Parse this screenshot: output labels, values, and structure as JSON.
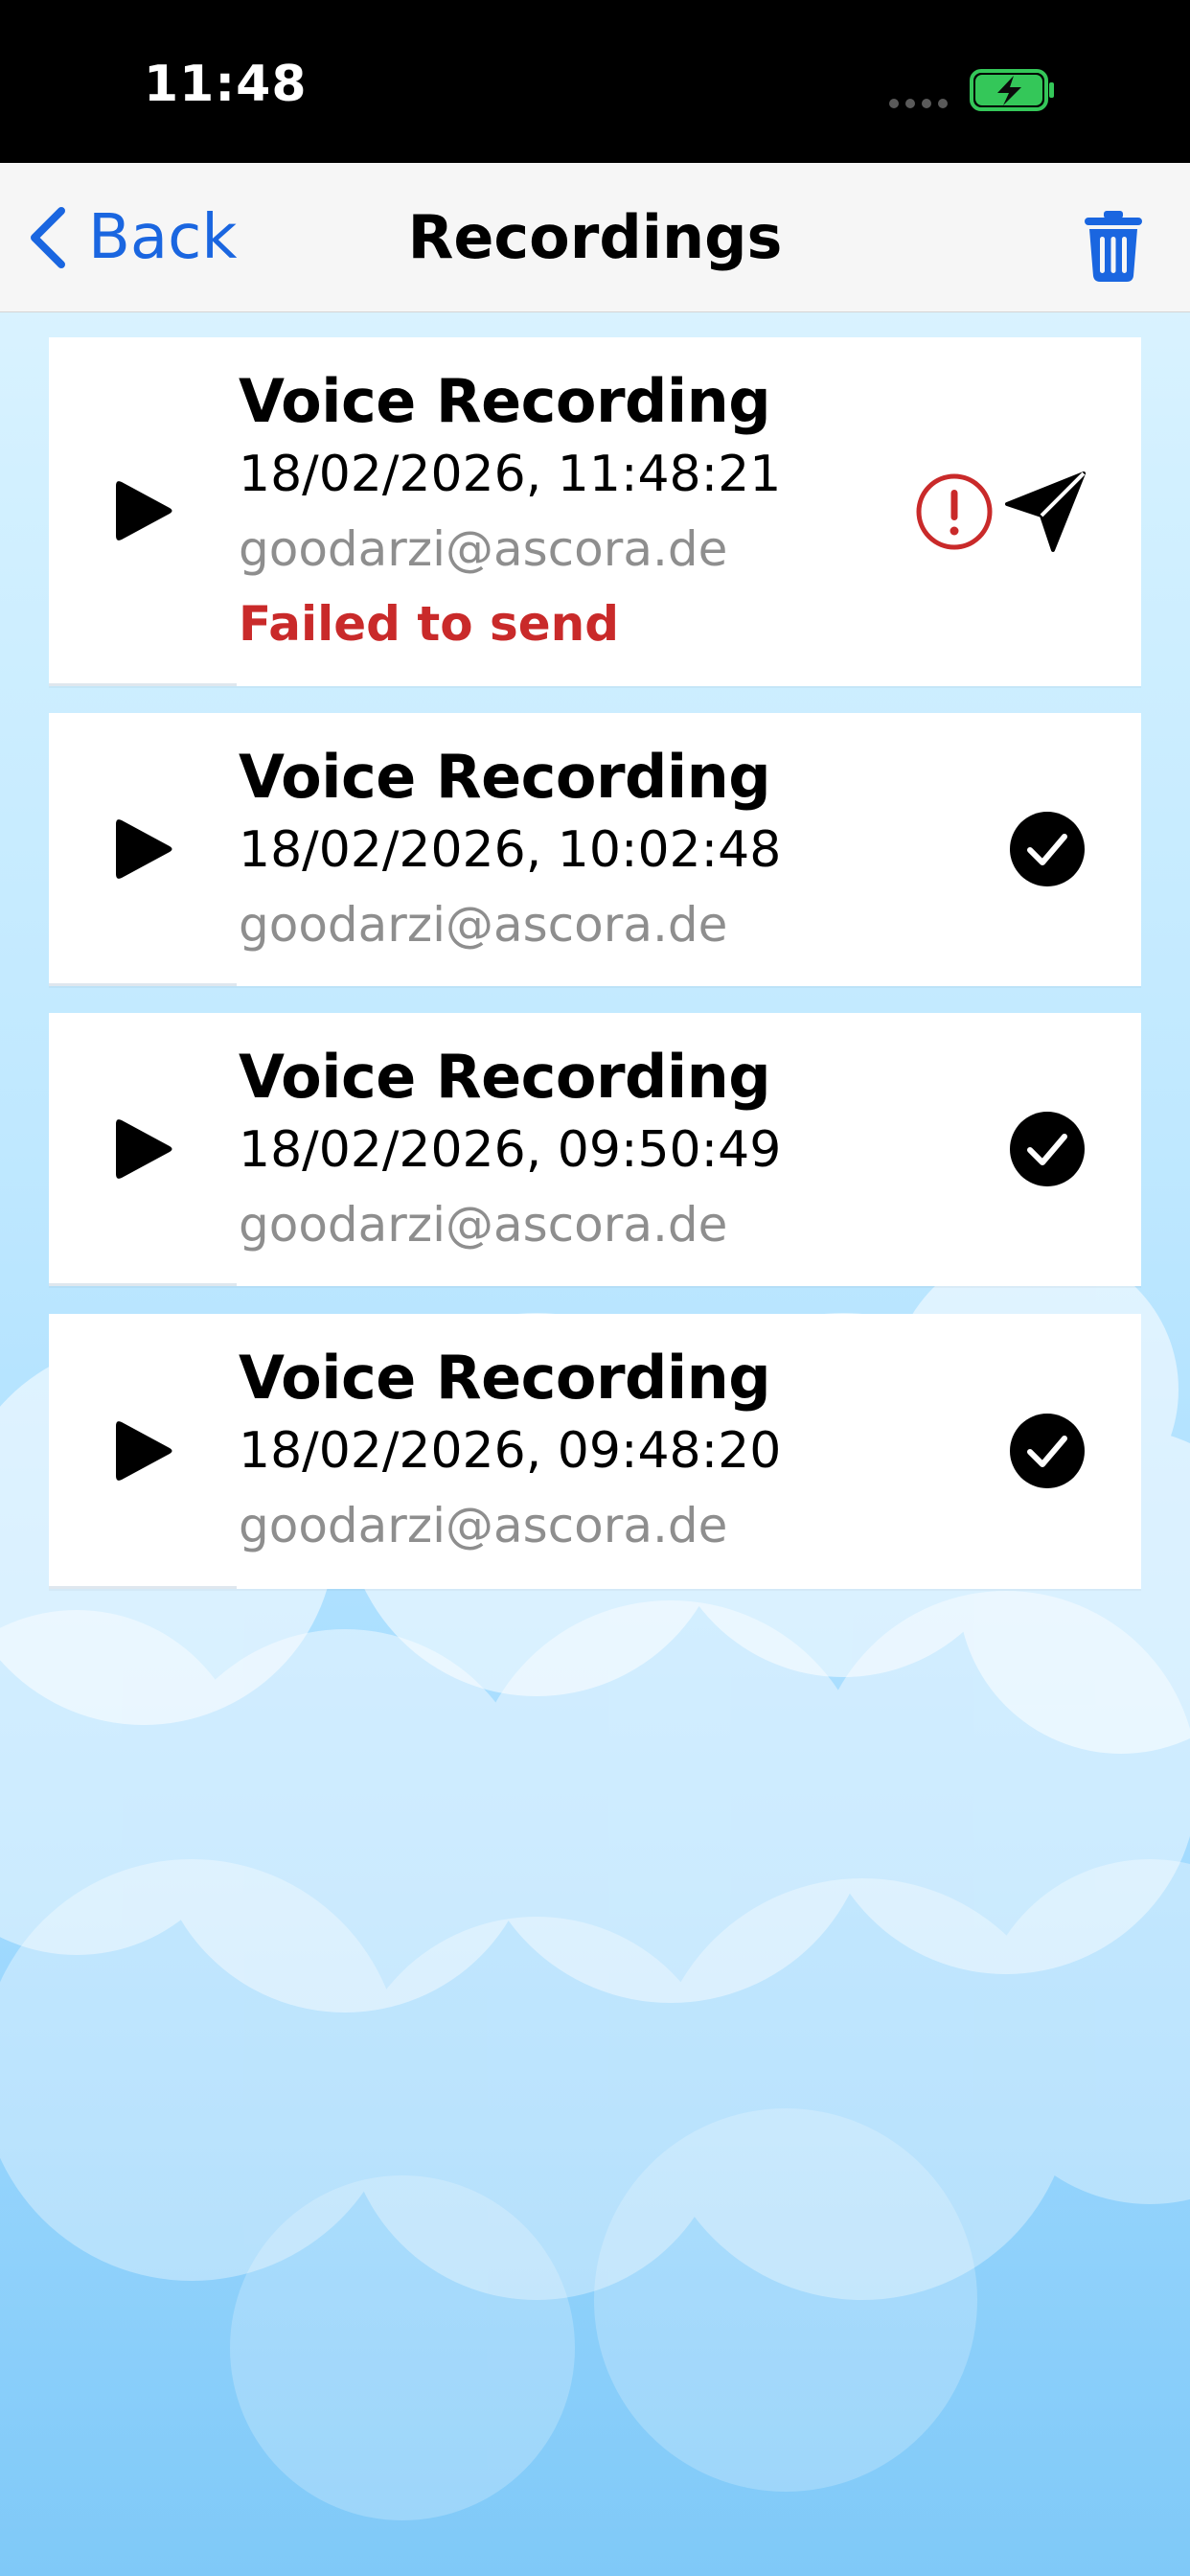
{
  "status_bar": {
    "time": "11:48"
  },
  "nav": {
    "back_label": "Back",
    "title": "Recordings"
  },
  "recordings": [
    {
      "title": "Voice Recording",
      "date": "18/02/2026, 11:48:21",
      "email": "goodarzi@ascora.de",
      "error": "Failed to send",
      "status": "failed"
    },
    {
      "title": "Voice Recording",
      "date": "18/02/2026, 10:02:48",
      "email": "goodarzi@ascora.de",
      "status": "sent"
    },
    {
      "title": "Voice Recording",
      "date": "18/02/2026, 09:50:49",
      "email": "goodarzi@ascora.de",
      "status": "sent"
    },
    {
      "title": "Voice Recording",
      "date": "18/02/2026, 09:48:20",
      "email": "goodarzi@ascora.de",
      "status": "sent"
    }
  ],
  "icons": {
    "back": "chevron-left-icon",
    "trash": "trash-icon",
    "play": "play-icon",
    "alert": "exclamation-circle-icon",
    "send": "paper-plane-icon",
    "sent": "checkmark-circle-icon",
    "battery": "battery-charging-icon"
  },
  "colors": {
    "accent": "#1a66e0",
    "error": "#c92a2a",
    "battery": "#34c759",
    "secondary_text": "#8e8e8e"
  }
}
